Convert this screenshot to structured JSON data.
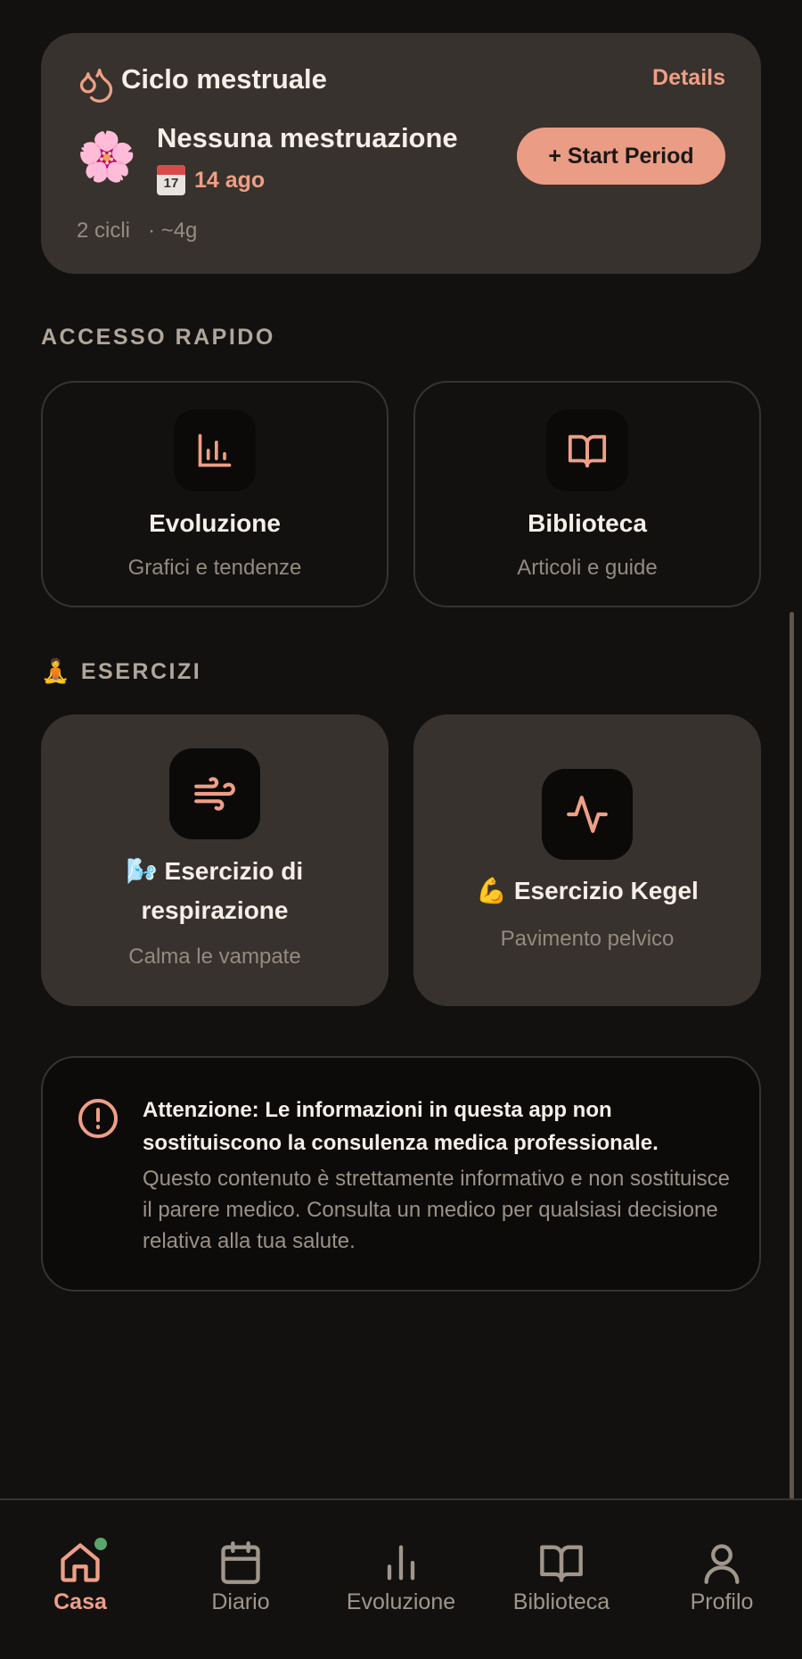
{
  "cycle": {
    "title": "Ciclo mestruale",
    "details_label": "Details",
    "status": "Nessuna mestruazione",
    "flower_emoji": "🌸",
    "calendar_day": "17",
    "date": "14 ago",
    "start_button": "+ Start Period",
    "cycles_count": "2 cicli",
    "avg_length": "· ~4g"
  },
  "quick_access": {
    "title": "ACCESSO RAPIDO",
    "tiles": [
      {
        "title": "Evoluzione",
        "subtitle": "Grafici e tendenze",
        "icon": "bar-chart-icon"
      },
      {
        "title": "Biblioteca",
        "subtitle": "Articoli e guide",
        "icon": "book-icon"
      }
    ]
  },
  "exercises": {
    "emoji": "🧘",
    "title": "ESERCIZI",
    "tiles": [
      {
        "emoji": "🌬️",
        "title_line1": "Esercizio di",
        "title_line2": "respirazione",
        "subtitle": "Calma le vampate",
        "icon": "wind-icon"
      },
      {
        "emoji": "💪",
        "title": "Esercizio Kegel",
        "subtitle": "Pavimento pelvico",
        "icon": "activity-icon"
      }
    ]
  },
  "disclaimer": {
    "title": "Attenzione: Le informazioni in questa app non sostituiscono la consulenza medica professionale.",
    "body": "Questo contenuto è strettamente informativo e non sostituisce il parere medico. Consulta un medico per qualsiasi decisione relativa alla tua salute."
  },
  "nav": {
    "items": [
      {
        "label": "Casa",
        "icon": "home-icon",
        "active": true
      },
      {
        "label": "Diario",
        "icon": "calendar-icon"
      },
      {
        "label": "Evoluzione",
        "icon": "bar-chart-icon"
      },
      {
        "label": "Biblioteca",
        "icon": "book-icon"
      },
      {
        "label": "Profilo",
        "icon": "user-icon"
      }
    ]
  },
  "colors": {
    "accent": "#ee9f86",
    "background": "#121110",
    "card": "#37322d",
    "notification_dot": "#5aa56a"
  }
}
